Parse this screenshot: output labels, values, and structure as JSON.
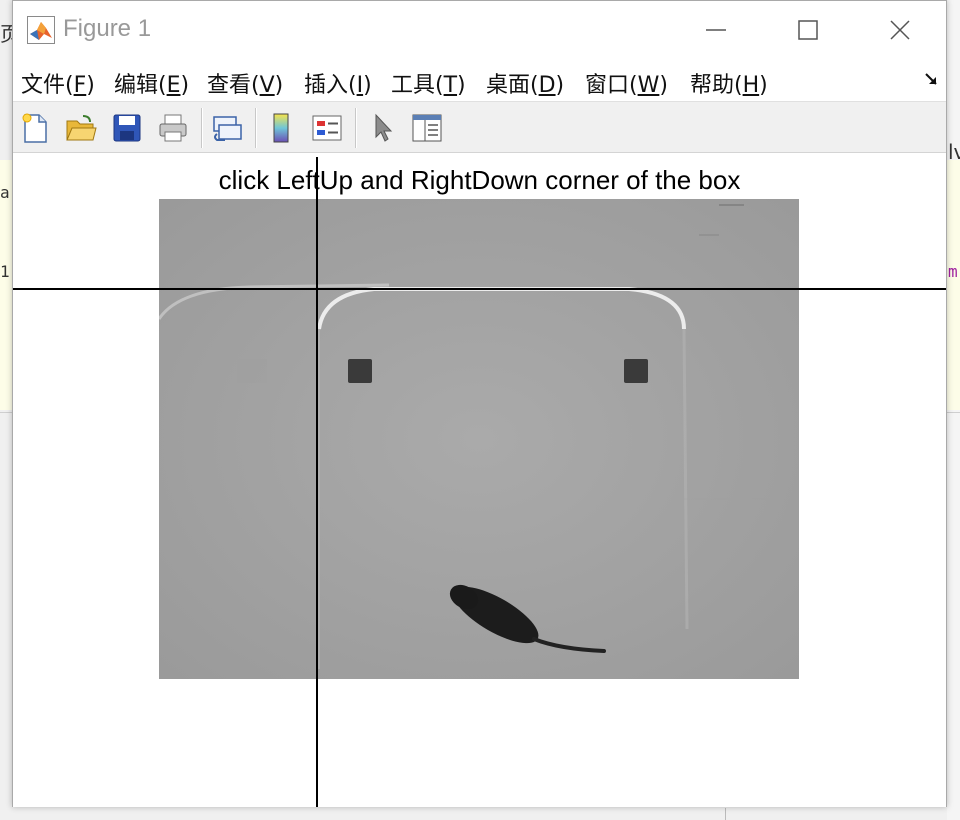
{
  "window": {
    "title": "Figure 1",
    "controls": {
      "minimize": "minimize",
      "maximize": "maximize",
      "close": "close"
    }
  },
  "menu": [
    {
      "label": "文件(",
      "key": "F",
      "suffix": ")"
    },
    {
      "label": "编辑(",
      "key": "E",
      "suffix": ")"
    },
    {
      "label": "查看(",
      "key": "V",
      "suffix": ")"
    },
    {
      "label": "插入(",
      "key": "I",
      "suffix": ")"
    },
    {
      "label": "工具(",
      "key": "T",
      "suffix": ")"
    },
    {
      "label": "桌面(",
      "key": "D",
      "suffix": ")"
    },
    {
      "label": "窗口(",
      "key": "W",
      "suffix": ")"
    },
    {
      "label": "帮助(",
      "key": "H",
      "suffix": ")"
    }
  ],
  "toolbar": {
    "icons": [
      "new-figure-icon",
      "open-file-icon",
      "save-icon",
      "print-icon",
      "link-icon",
      "colorbar-icon",
      "legend-icon",
      "pointer-icon",
      "property-inspector-icon"
    ]
  },
  "axes": {
    "title": "click LeftUp and RightDown corner of the box"
  },
  "background_fragments": {
    "left_top": "页",
    "left_mid1": "a",
    "left_mid2": "1",
    "right_top": "lv",
    "right_mid": "m"
  },
  "colors": {
    "window_bg": "#ffffff",
    "toolbar_bg": "#f0f0f0",
    "title_text": "#999999",
    "image_gray": "#a6a6a6",
    "crosshair": "#000000"
  }
}
